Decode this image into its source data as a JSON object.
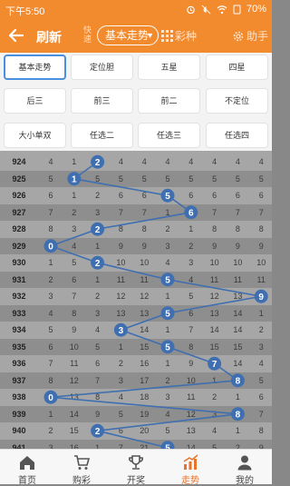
{
  "status": {
    "time": "下午5:50",
    "battery": "70%"
  },
  "header": {
    "refresh": "刷新",
    "quick": "快速",
    "trend_select": "基本走势",
    "color_label": "彩种",
    "helper_label": "助手"
  },
  "menu": {
    "items": [
      "基本走势",
      "定位胆",
      "五星",
      "四星",
      "后三",
      "前三",
      "前二",
      "不定位",
      "大小单双",
      "任选二",
      "任选三",
      "任选四"
    ],
    "active": "基本走势"
  },
  "table": {
    "rows": [
      {
        "issue": "924",
        "cells": [
          "4",
          "1",
          "2",
          "4",
          "4",
          "4",
          "4",
          "4",
          "4",
          "4"
        ],
        "hit": 2
      },
      {
        "issue": "925",
        "cells": [
          "5",
          "1",
          "5",
          "5",
          "5",
          "5",
          "5",
          "5",
          "5",
          "5"
        ],
        "hit": 1
      },
      {
        "issue": "926",
        "cells": [
          "6",
          "1",
          "2",
          "6",
          "6",
          "5",
          "6",
          "6",
          "6",
          "6"
        ],
        "hit": 5
      },
      {
        "issue": "927",
        "cells": [
          "7",
          "2",
          "3",
          "7",
          "7",
          "1",
          "6",
          "7",
          "7",
          "7"
        ],
        "hit": 6
      },
      {
        "issue": "928",
        "cells": [
          "8",
          "3",
          "2",
          "8",
          "8",
          "2",
          "1",
          "8",
          "8",
          "8"
        ],
        "hit": 2
      },
      {
        "issue": "929",
        "cells": [
          "0",
          "4",
          "1",
          "9",
          "9",
          "3",
          "2",
          "9",
          "9",
          "9"
        ],
        "hit": 0
      },
      {
        "issue": "930",
        "cells": [
          "1",
          "5",
          "2",
          "10",
          "10",
          "4",
          "3",
          "10",
          "10",
          "10"
        ],
        "hit": 2
      },
      {
        "issue": "931",
        "cells": [
          "2",
          "6",
          "1",
          "11",
          "11",
          "5",
          "4",
          "11",
          "11",
          "11"
        ],
        "hit": 5
      },
      {
        "issue": "932",
        "cells": [
          "3",
          "7",
          "2",
          "12",
          "12",
          "1",
          "5",
          "12",
          "13",
          "9"
        ],
        "hit": 9
      },
      {
        "issue": "933",
        "cells": [
          "4",
          "8",
          "3",
          "13",
          "13",
          "5",
          "6",
          "13",
          "14",
          "1"
        ],
        "hit": 5
      },
      {
        "issue": "934",
        "cells": [
          "5",
          "9",
          "4",
          "3",
          "14",
          "1",
          "7",
          "14",
          "14",
          "2"
        ],
        "hit": 3
      },
      {
        "issue": "935",
        "cells": [
          "6",
          "10",
          "5",
          "1",
          "15",
          "5",
          "8",
          "15",
          "15",
          "3"
        ],
        "hit": 5
      },
      {
        "issue": "936",
        "cells": [
          "7",
          "11",
          "6",
          "2",
          "16",
          "1",
          "9",
          "7",
          "14",
          "4"
        ],
        "hit": 7
      },
      {
        "issue": "937",
        "cells": [
          "8",
          "12",
          "7",
          "3",
          "17",
          "2",
          "10",
          "1",
          "8",
          "5"
        ],
        "hit": 8
      },
      {
        "issue": "938",
        "cells": [
          "0",
          "13",
          "8",
          "4",
          "18",
          "3",
          "11",
          "2",
          "1",
          "6"
        ],
        "hit": 0
      },
      {
        "issue": "939",
        "cells": [
          "1",
          "14",
          "9",
          "5",
          "19",
          "4",
          "12",
          "3",
          "8",
          "7"
        ],
        "hit": 8
      },
      {
        "issue": "940",
        "cells": [
          "2",
          "15",
          "2",
          "6",
          "20",
          "5",
          "13",
          "4",
          "1",
          "8"
        ],
        "hit": 2
      },
      {
        "issue": "941",
        "cells": [
          "3",
          "16",
          "1",
          "7",
          "21",
          "5",
          "14",
          "5",
          "2",
          "9"
        ],
        "hit": 5
      }
    ]
  },
  "colors": {
    "accent": "#f28a2e",
    "ball": "#3f6fb0",
    "tab_active": "#e8732a"
  },
  "tabs": [
    {
      "label": "首页",
      "icon": "home-icon"
    },
    {
      "label": "购彩",
      "icon": "cart-icon"
    },
    {
      "label": "开奖",
      "icon": "trophy-icon"
    },
    {
      "label": "走势",
      "icon": "chart-icon",
      "active": true
    },
    {
      "label": "我的",
      "icon": "user-icon"
    }
  ]
}
